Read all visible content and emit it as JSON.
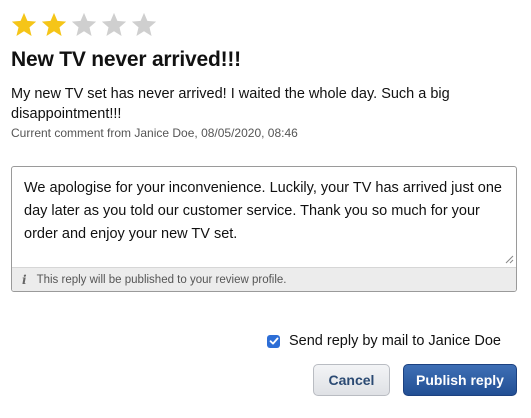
{
  "review": {
    "rating": 2,
    "max_rating": 5,
    "title": "New TV never arrived!!!",
    "body": "My new TV set has never arrived! I waited the whole day. Such a big disappointment!!!",
    "meta": "Current comment from Janice Doe, 08/05/2020, 08:46"
  },
  "reply": {
    "text": "We apologise for your inconvenience. Luckily, your TV has arrived just one day later as you told our customer service. Thank you so much for your order and enjoy your new TV set.",
    "hint": "This reply will be published to your review profile.",
    "info_icon": "i"
  },
  "mail_option": {
    "label": "Send reply by mail to Janice Doe",
    "checked": true
  },
  "buttons": {
    "cancel": "Cancel",
    "publish": "Publish reply"
  },
  "colors": {
    "star_filled": "#f5c518",
    "star_empty": "#cfcfcf",
    "accent": "#2d6ed6",
    "primary_button": "#2a5aa0"
  }
}
